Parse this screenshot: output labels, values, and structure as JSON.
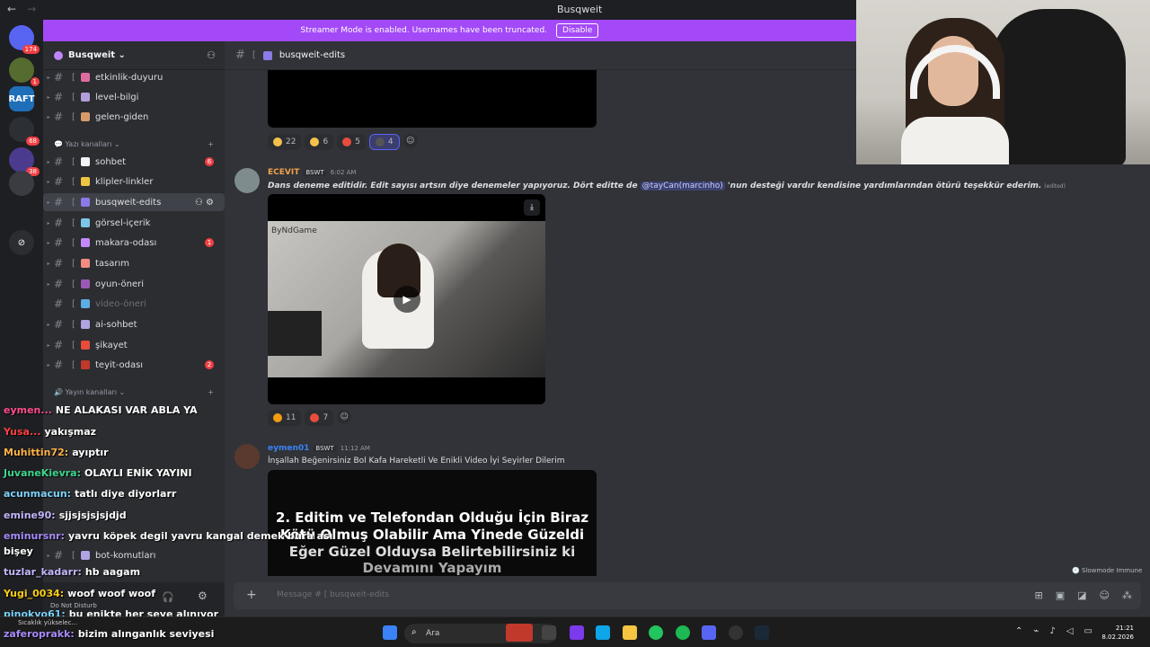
{
  "window": {
    "title": "Busqweit",
    "back": "←",
    "forward": "→"
  },
  "banner": {
    "text": "Streamer Mode is enabled. Usernames have been truncated.",
    "button": "Disable"
  },
  "servers": [
    {
      "label": "",
      "badge": "174"
    },
    {
      "label": "",
      "badge": "1"
    },
    {
      "label": "RAFT",
      "badge": ""
    },
    {
      "label": "",
      "badge": "68"
    },
    {
      "label": "",
      "badge": "38"
    },
    {
      "label": "",
      "badge": ""
    },
    {
      "label": "",
      "badge": ""
    }
  ],
  "guild": {
    "name": "Busqweit ⌄",
    "add_icon": "person-add-icon"
  },
  "channels_top": [
    {
      "name": "etkinlik-duyuru",
      "emoji_color": "#e06c9f"
    },
    {
      "name": "level-bilgi",
      "emoji_color": "#b39ddb"
    },
    {
      "name": "gelen-giden",
      "emoji_color": "#d79b6b"
    }
  ],
  "category_text": {
    "label": "💬 Yazı kanalları ⌄",
    "add": "+"
  },
  "channels_text": [
    {
      "name": "sohbet",
      "emoji_color": "#f2f3f5",
      "count": "6",
      "muted": false
    },
    {
      "name": "klipler-linkler",
      "emoji_color": "#f0c541",
      "count": "",
      "muted": false
    },
    {
      "name": "busqweit-edits",
      "emoji_color": "#8c7ae6",
      "count": "",
      "muted": false,
      "active": true
    },
    {
      "name": "görsel-içerik",
      "emoji_color": "#7cc5e8",
      "count": "",
      "muted": false
    },
    {
      "name": "makara-odası",
      "emoji_color": "#c38af7",
      "count": "1",
      "muted": false
    },
    {
      "name": "tasarım",
      "emoji_color": "#f28b82",
      "count": "",
      "muted": false
    },
    {
      "name": "oyun-öneri",
      "emoji_color": "#9b59b6",
      "count": "",
      "muted": false
    },
    {
      "name": "video-öneri",
      "emoji_color": "#5dade2",
      "count": "",
      "muted": true
    },
    {
      "name": "ai-sohbet",
      "emoji_color": "#b0a4e3",
      "count": "",
      "muted": false
    },
    {
      "name": "şikayet",
      "emoji_color": "#e74c3c",
      "count": "",
      "muted": false
    },
    {
      "name": "teyit-odası",
      "emoji_color": "#c0392b",
      "count": "2",
      "muted": false
    }
  ],
  "category_stream": {
    "label": "🔊 Yayın kanalları ⌄",
    "add": "+"
  },
  "channel_bot": {
    "name": "bot-komutları"
  },
  "topbar": {
    "hash": "#",
    "channel": "busqweit-edits",
    "bracket": "["
  },
  "message1_reactions": [
    {
      "emoji_color": "#f5c04a",
      "count": "22",
      "active": false
    },
    {
      "emoji_color": "#f5c04a",
      "count": "6",
      "active": false
    },
    {
      "emoji_color": "#e74c3c",
      "count": "5",
      "active": false
    },
    {
      "emoji_color": "#555555",
      "count": "4",
      "active": true
    }
  ],
  "message2": {
    "author": "ECEVIT",
    "role": "BSWT",
    "time": "6:02 AM",
    "text_before": "Dans deneme editidir. Edit sayısı artsın diye denemeler yapıyoruz. Dört editte de ",
    "mention": "@tayCan(marcinho)",
    "text_after": " 'nun desteği vardır kendisine yardımlarından ötürü teşekkür ederim.",
    "edited": "(edited)",
    "video_watermark": "ByNdGame",
    "reactions": [
      {
        "emoji_color": "#f39c12",
        "count": "11"
      },
      {
        "emoji_color": "#e74c3c",
        "count": "7"
      }
    ]
  },
  "message3": {
    "author": "eymen01",
    "role": "BSWT",
    "time": "11:12 AM",
    "text": "İnşallah Beğenirsiniz Bol Kafa Hareketli Ve Enikli Video İyi Seyirler Dilerim",
    "thumb_lines": [
      "2. Editim ve Telefondan Olduğu İçin Biraz",
      "Kötü Olmuş Olabilir Ama Yinede Güzeldi",
      "Eğer Güzel Olduysa Belirtebilirsiniz ki",
      "Devamını Yapayım"
    ]
  },
  "slowmode": "🕘 Slowmode Immune",
  "composer": {
    "plus": "+",
    "placeholder": "Message # [ busqweit-edits"
  },
  "overlay_chat": [
    {
      "user": "eymen...",
      "user_color": "#ff4d8d",
      "text": "NE ALAKASI VAR ABLA YA"
    },
    {
      "user": "Yusa...",
      "user_color": "#ff4040",
      "text": "yakışmaz"
    },
    {
      "user": "Muhittin72:",
      "user_color": "#ffb347",
      "text": "ayıptır"
    },
    {
      "user": "JuvaneKievra:",
      "user_color": "#3cd68c",
      "text": "OLAYLI ENİK YAYINI"
    },
    {
      "user": "acunmacun:",
      "user_color": "#7dd3fc",
      "text": "tatlı diye diyorlarr"
    },
    {
      "user": "emine90:",
      "user_color": "#c4b5fd",
      "text": "sjjsjsjsjsjdjd"
    },
    {
      "user": "eminursnr:",
      "user_color": "#a78bfa",
      "text": "yavru köpek degil yavru kangal demek bura asıl"
    },
    {
      "user": "",
      "user_color": "#ffffff",
      "text": "bişey"
    },
    {
      "user": "tuzlar_kadarr:",
      "user_color": "#c4b5fd",
      "text": "hb aagam"
    },
    {
      "user": "Yugi_0034:",
      "user_color": "#facc15",
      "text": "woof woof woof"
    },
    {
      "user": "pinokyo61:",
      "user_color": "#7dd3fc",
      "text": "bu enikte her şeye alınıyor"
    },
    {
      "user": "zaferoprakk:",
      "user_color": "#a78bfa",
      "text": "bizim alınganlık seviyesi"
    }
  ],
  "userpanel": {
    "status": "Do Not Disturb"
  },
  "taskbar": {
    "weather": "Sıcaklık yükselec...",
    "search_placeholder": "Ara",
    "time": "21:21",
    "date": "8.02.2026"
  }
}
